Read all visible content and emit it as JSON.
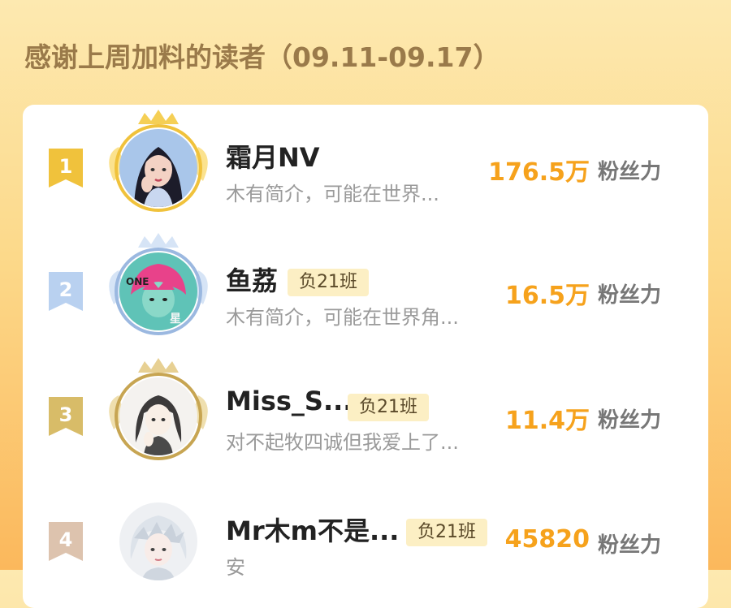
{
  "header": {
    "title": "感谢上周加料的读者（09.11-09.17）"
  },
  "fans_label": "粉丝力",
  "colors": {
    "gold": "#f0c23c",
    "silver": "#b9d1f0",
    "bronze": "#d8bc68",
    "rank4": "#ddc3ae",
    "accent": "#f6a21c"
  },
  "readers": [
    {
      "rank": "1",
      "name": "霜月NV",
      "badge": "",
      "desc": "木有简介，可能在世界...",
      "fans": "176.5万",
      "avatar_icon": "avatar-girl-icon"
    },
    {
      "rank": "2",
      "name": "鱼荔",
      "badge": "负21班",
      "desc": "木有简介，可能在世界角...",
      "fans": "16.5万",
      "avatar_icon": "avatar-anime-pink-hair-icon"
    },
    {
      "rank": "3",
      "name": "Miss_S...",
      "badge": "负21班",
      "desc": "对不起牧四诚但我爱上了...",
      "fans": "11.4万",
      "avatar_icon": "avatar-sketch-girl-icon"
    },
    {
      "rank": "4",
      "name": "Mr木m不是...",
      "badge": "负21班",
      "desc": "安",
      "fans": "45820",
      "avatar_icon": "avatar-white-hair-icon"
    }
  ]
}
